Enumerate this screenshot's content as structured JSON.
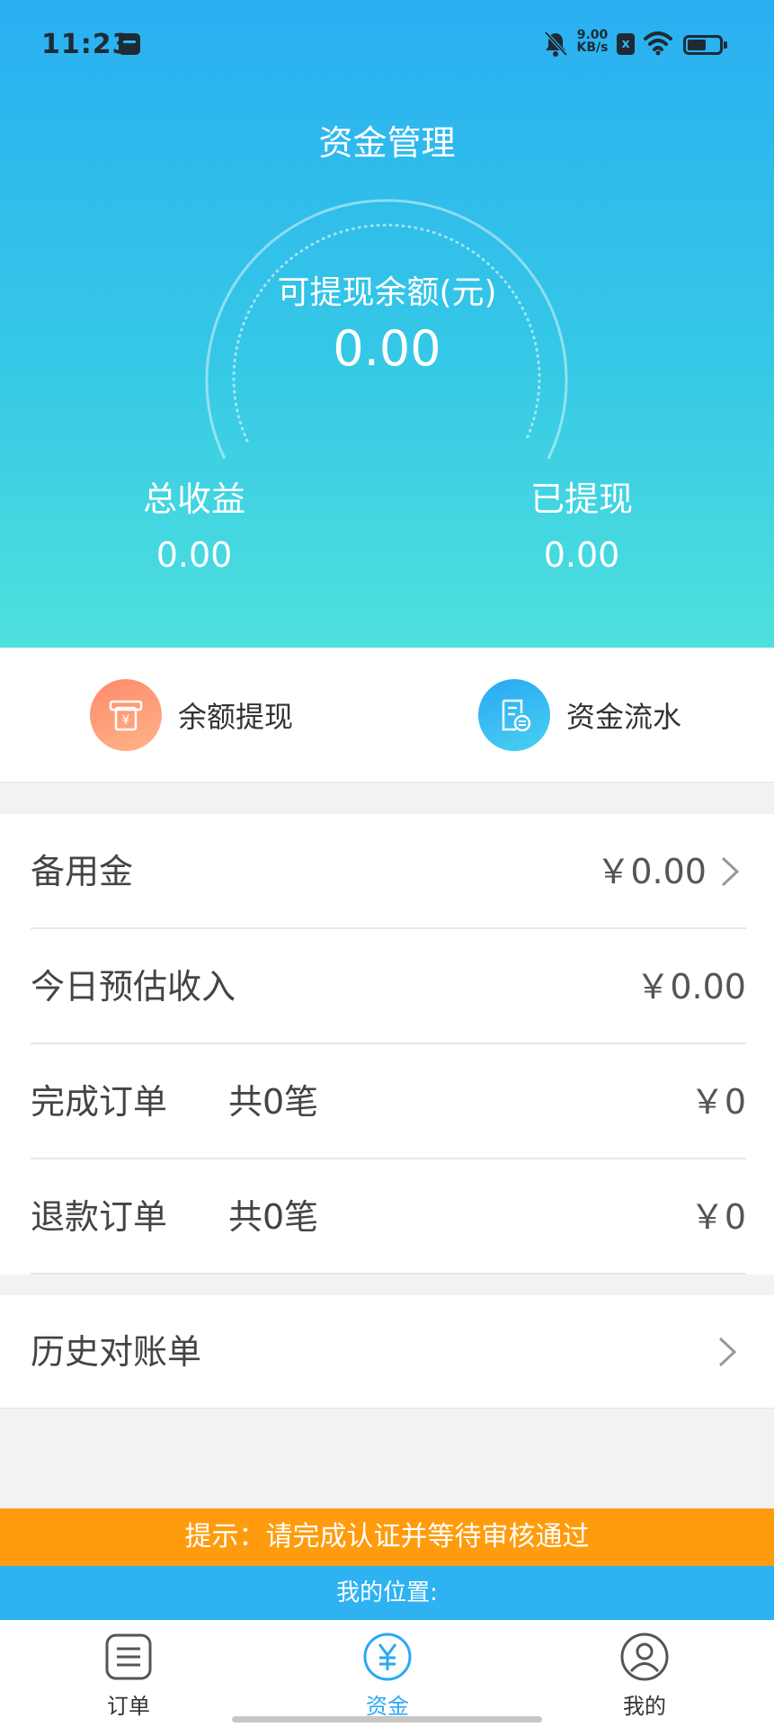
{
  "status_bar": {
    "time": "11:23",
    "net_speed_value": "9.00",
    "net_speed_unit": "KB/s",
    "sim_badge": "x",
    "icons": [
      "app-icon",
      "bell-muted-icon",
      "sim-icon",
      "wifi-icon",
      "battery-icon"
    ]
  },
  "header": {
    "title": "资金管理",
    "balance_label": "可提现余额(元)",
    "balance_value": "0.00",
    "total_income_label": "总收益",
    "total_income_value": "0.00",
    "withdrawn_label": "已提现",
    "withdrawn_value": "0.00",
    "gradient_colors": [
      "#2aaff2",
      "#4fe0dd"
    ]
  },
  "actions": [
    {
      "label": "余额提现",
      "icon": "withdraw-icon",
      "color": "#ff9a78"
    },
    {
      "label": "资金流水",
      "icon": "statement-icon",
      "color": "#35b8f2"
    }
  ],
  "list": {
    "reserve": {
      "label": "备用金",
      "value": "￥0.00"
    },
    "today_income": {
      "label": "今日预估收入",
      "value": "￥0.00"
    },
    "completed_orders": {
      "label": "完成订单",
      "count": "共0笔",
      "value": "￥0"
    },
    "refund_orders": {
      "label": "退款订单",
      "count": "共0笔",
      "value": "￥0"
    }
  },
  "history": {
    "label": "历史对账单"
  },
  "tip_banner": {
    "text": "提示：请完成认证并等待审核通过",
    "color": "#ff9c0e"
  },
  "location_banner": {
    "text": "我的位置:",
    "color": "#2eb2f2"
  },
  "tabbar": {
    "orders_label": "订单",
    "funds_label": "资金",
    "mine_label": "我的",
    "active": "资金",
    "active_color": "#2aa8f2"
  }
}
